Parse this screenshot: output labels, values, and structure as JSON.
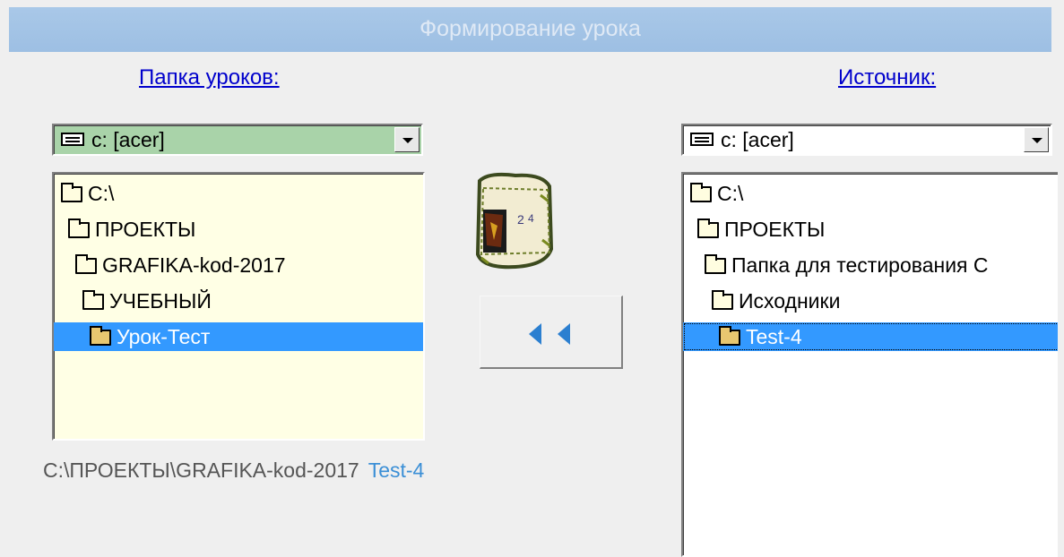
{
  "window": {
    "title": "Формирование урока"
  },
  "left_panel": {
    "label": "Папка уроков:",
    "drive": "c: [acer]",
    "tree": [
      "C:\\",
      "ПРОЕКТЫ",
      "GRAFIKA-kod-2017",
      "УЧЕБНЫЙ",
      "Урок-Тест"
    ],
    "selected_index": 4
  },
  "right_panel": {
    "label": "Источник:",
    "drive": "c: [acer]",
    "tree": [
      "C:\\",
      "ПРОЕКТЫ",
      "Папка для тестирования С",
      "Исходники",
      "Test-4"
    ],
    "selected_index": 4
  },
  "status": {
    "path": "C:\\ПРОЕКТЫ\\GRAFIKA-kod-2017",
    "selected": "Test-4"
  },
  "copy_button": {
    "icon": "double-left-arrow-icon"
  },
  "colors": {
    "titlebar": "#a9c8e8",
    "left_combo_bg": "#a9d3a9",
    "left_tree_bg": "#ffffe5",
    "right_bg": "#ffffff",
    "selection": "#3399ff",
    "arrow": "#2b7fd0"
  }
}
